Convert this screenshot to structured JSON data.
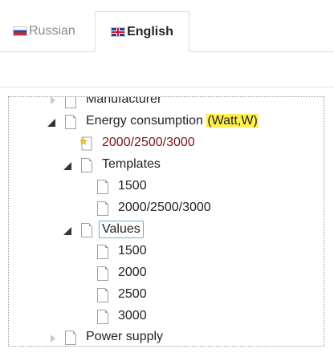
{
  "tabs": [
    {
      "label": "Russian",
      "flag": "ru-flag",
      "active": false
    },
    {
      "label": "English",
      "flag": "gb-flag",
      "active": true
    }
  ],
  "tree": {
    "manufacturer": "Manufacturer",
    "energy_prefix": "Energy consumption",
    "energy_highlight": "(Watt,W)",
    "favorite": "2000/2500/3000",
    "templates": {
      "label": "Templates",
      "children": [
        "1500",
        "2000/2500/3000"
      ]
    },
    "values": {
      "label": "Values",
      "children": [
        "1500",
        "2000",
        "2500",
        "3000"
      ]
    },
    "power_supply": "Power supply"
  },
  "colors": {
    "highlight": "#fff04d",
    "favorite_text": "#7a1414",
    "selection_border": "#7aa7d6"
  }
}
